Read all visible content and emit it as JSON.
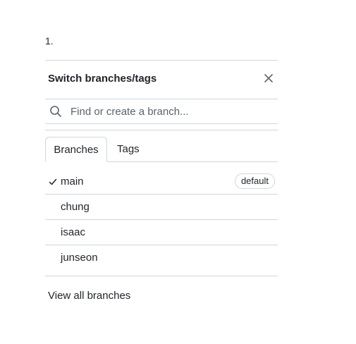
{
  "list_marker": "1.",
  "header": {
    "title": "Switch branches/tags",
    "close_icon": "close-icon"
  },
  "search": {
    "placeholder": "Find or create a branch...",
    "value": "",
    "icon": "search-icon"
  },
  "tabs": [
    {
      "label": "Branches",
      "active": true
    },
    {
      "label": "Tags",
      "active": false
    }
  ],
  "branches": [
    {
      "name": "main",
      "checked": true,
      "badge": "default"
    },
    {
      "name": "chung",
      "checked": false
    },
    {
      "name": "isaac",
      "checked": false
    },
    {
      "name": "junseon",
      "checked": false
    }
  ],
  "footer": {
    "view_all_label": "View all branches"
  },
  "colors": {
    "border": "#d0d7de",
    "text": "#1f2328",
    "muted": "#59636e"
  }
}
